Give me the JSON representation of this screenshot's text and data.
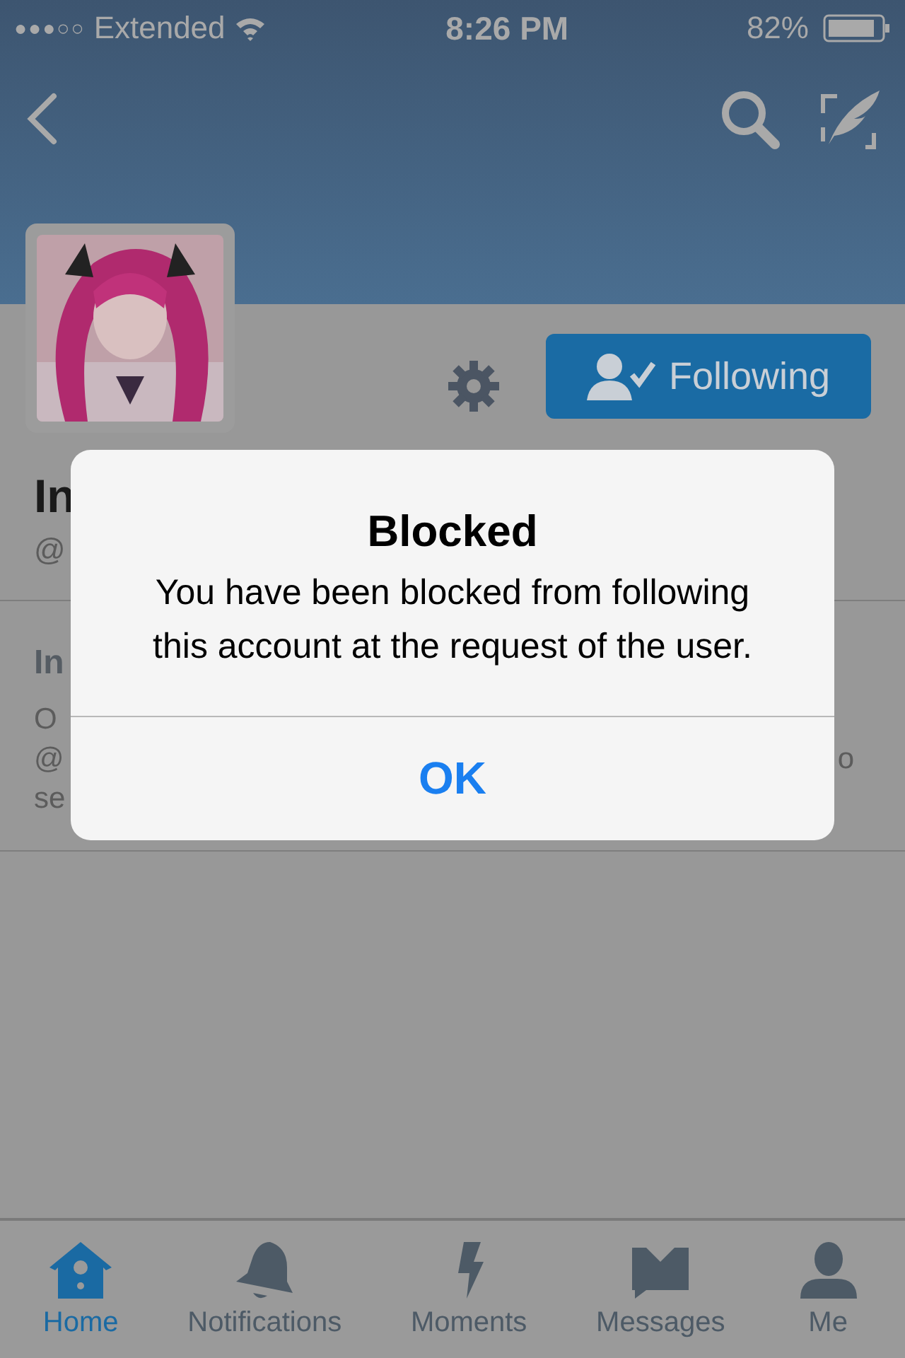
{
  "status_bar": {
    "signal": "●●●○○",
    "carrier": "Extended",
    "time": "8:26 PM",
    "battery": "82%"
  },
  "profile": {
    "name": "In",
    "handle": "@",
    "follow_button": {
      "label": "Following",
      "following": true
    }
  },
  "notice": {
    "title": "In",
    "lines": [
      {
        "left": "O"
      },
      {
        "left": "@",
        "right": "o"
      },
      {
        "left": "se"
      }
    ]
  },
  "alert": {
    "title": "Blocked",
    "message": "You have been blocked from following this account at the request of the user.",
    "buttons": [
      "OK"
    ]
  },
  "tab_bar": [
    {
      "label": "Home",
      "selected": true
    },
    {
      "label": "Notifications",
      "selected": false
    },
    {
      "label": "Moments",
      "selected": false
    },
    {
      "label": "Messages",
      "selected": false
    },
    {
      "label": "Me",
      "selected": false
    }
  ]
}
